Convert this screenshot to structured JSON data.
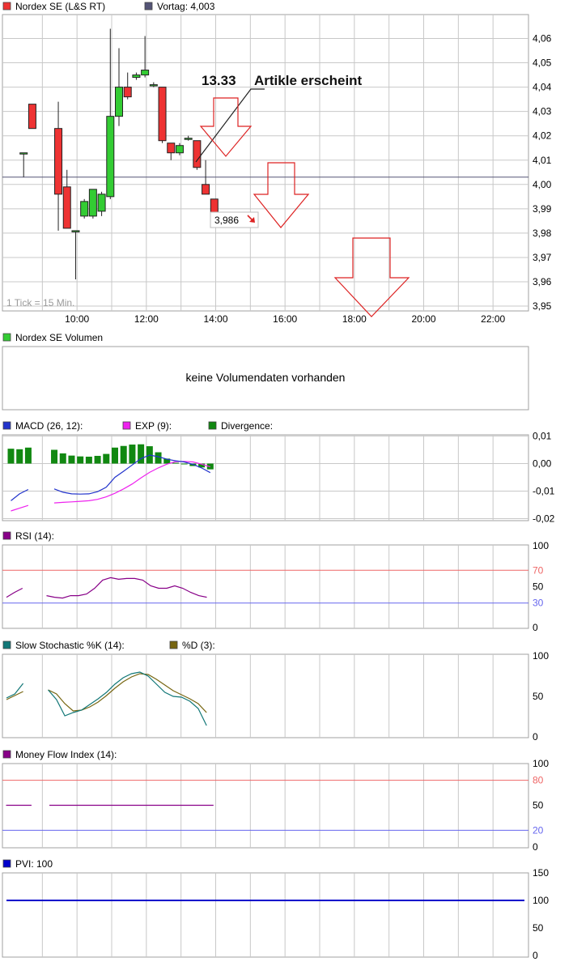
{
  "colors": {
    "up": "#33cc33",
    "down": "#ee3333",
    "grid": "#c8c8c8",
    "frame": "#a0a0a0",
    "prevclose": "#555577",
    "macd": "#2233cc",
    "exp": "#ee22ee",
    "divergence": "#118811",
    "rsi": "#880088",
    "level_high": "#ee6666",
    "level_low": "#6666ee",
    "stoch_k": "#117777",
    "stoch_d": "#776611",
    "mfi": "#880088",
    "pvi": "#0000cc",
    "arrow": "#dd2222"
  },
  "price_panel": {
    "legend_main": "Nordex SE (L&S RT)",
    "legend_prev": "Vortag: 4,003",
    "tick_info": "1 Tick = 15 Min.",
    "last_price_label": "3,986",
    "annotation_time": "13.33",
    "annotation_text": "Artikle erscheint"
  },
  "volume_panel": {
    "legend": "Nordex SE Volumen",
    "no_data": "keine Volumendaten vorhanden"
  },
  "macd_panel": {
    "legend_macd": "MACD (26, 12):",
    "legend_exp": "EXP (9):",
    "legend_div": "Divergence:"
  },
  "rsi_panel": {
    "legend": "RSI (14):"
  },
  "stoch_panel": {
    "legend_k": "Slow Stochastic %K (14):",
    "legend_d": "%D (3):"
  },
  "mfi_panel": {
    "legend": "Money Flow Index (14):"
  },
  "pvi_panel": {
    "legend": "PVI: 100"
  },
  "chart_data": [
    {
      "type": "candlestick",
      "name": "Nordex SE (L&S RT)",
      "interval_minutes": 15,
      "x_tick_labels": [
        "10:00",
        "12:00",
        "14:00",
        "16:00",
        "18:00",
        "20:00",
        "22:00"
      ],
      "xlim": [
        "08:00",
        "23:00"
      ],
      "ylim": [
        3.95,
        4.065
      ],
      "y_ticks": [
        "4,06",
        "4,05",
        "4,04",
        "4,03",
        "4,02",
        "4,01",
        "4,00",
        "3,99",
        "3,98",
        "3,97",
        "3,96",
        "3,95"
      ],
      "prev_close": 4.003,
      "candles": [
        {
          "t": "08:15",
          "o": 4.013,
          "h": 4.013,
          "l": 4.003,
          "c": 4.013
        },
        {
          "t": "08:30",
          "o": 4.033,
          "h": 4.033,
          "l": 4.023,
          "c": 4.023
        },
        {
          "t": "09:15",
          "o": 4.023,
          "h": 4.034,
          "l": 3.981,
          "c": 3.996
        },
        {
          "t": "09:30",
          "o": 3.999,
          "h": 4.006,
          "l": 3.982,
          "c": 3.982
        },
        {
          "t": "09:45",
          "o": 3.981,
          "h": 3.981,
          "l": 3.961,
          "c": 3.981
        },
        {
          "t": "10:00",
          "o": 3.987,
          "h": 3.994,
          "l": 3.986,
          "c": 3.993
        },
        {
          "t": "10:15",
          "o": 3.987,
          "h": 3.998,
          "l": 3.986,
          "c": 3.998
        },
        {
          "t": "10:30",
          "o": 3.989,
          "h": 3.997,
          "l": 3.987,
          "c": 3.996
        },
        {
          "t": "10:45",
          "o": 3.995,
          "h": 4.064,
          "l": 3.994,
          "c": 4.028
        },
        {
          "t": "11:00",
          "o": 4.028,
          "h": 4.056,
          "l": 4.024,
          "c": 4.04
        },
        {
          "t": "11:15",
          "o": 4.04,
          "h": 4.046,
          "l": 4.035,
          "c": 4.036
        },
        {
          "t": "11:30",
          "o": 4.044,
          "h": 4.046,
          "l": 4.043,
          "c": 4.045
        },
        {
          "t": "11:45",
          "o": 4.045,
          "h": 4.061,
          "l": 4.044,
          "c": 4.047
        },
        {
          "t": "12:00",
          "o": 4.041,
          "h": 4.042,
          "l": 4.04,
          "c": 4.041
        },
        {
          "t": "12:15",
          "o": 4.04,
          "h": 4.04,
          "l": 4.017,
          "c": 4.018
        },
        {
          "t": "12:30",
          "o": 4.017,
          "h": 4.017,
          "l": 4.01,
          "c": 4.013
        },
        {
          "t": "12:45",
          "o": 4.013,
          "h": 4.017,
          "l": 4.012,
          "c": 4.016
        },
        {
          "t": "13:00",
          "o": 4.019,
          "h": 4.02,
          "l": 4.018,
          "c": 4.019
        },
        {
          "t": "13:15",
          "o": 4.018,
          "h": 4.018,
          "l": 4.006,
          "c": 4.007
        },
        {
          "t": "13:30",
          "o": 4.0,
          "h": 4.01,
          "l": 3.996,
          "c": 3.996
        },
        {
          "t": "13:45",
          "o": 3.994,
          "h": 3.994,
          "l": 3.984,
          "c": 3.986
        }
      ]
    },
    {
      "type": "line",
      "name": "MACD (26, 12)",
      "ylim": [
        -0.02,
        0.01
      ],
      "y_ticks": [
        "0,01",
        "0,00",
        "-0,01",
        "-0,02"
      ],
      "times": [
        "08:00",
        "08:15",
        "08:30",
        "08:45",
        "09:00",
        "09:15",
        "09:30",
        "09:45",
        "10:00",
        "10:15",
        "10:30",
        "10:45",
        "11:00",
        "11:15",
        "11:30",
        "11:45",
        "12:00",
        "12:15",
        "12:30",
        "12:45",
        "13:00",
        "13:15",
        "13:30",
        "13:45"
      ],
      "series": [
        {
          "name": "MACD",
          "values": [
            -0.0135,
            -0.011,
            -0.0094,
            null,
            null,
            -0.0092,
            -0.0104,
            -0.011,
            -0.0111,
            -0.011,
            -0.0102,
            -0.0086,
            -0.005,
            -0.0028,
            -0.0005,
            0.0018,
            0.0031,
            0.0025,
            0.0016,
            0.001,
            0.0006,
            -0.0003,
            -0.0016,
            -0.0033
          ]
        },
        {
          "name": "EXP (9)",
          "values": [
            -0.0172,
            -0.0162,
            -0.0152,
            null,
            null,
            -0.0143,
            -0.0141,
            -0.0139,
            -0.0137,
            -0.0135,
            -0.013,
            -0.0121,
            -0.0108,
            -0.0092,
            -0.0074,
            -0.0052,
            -0.0032,
            -0.0016,
            -0.0002,
            0.0007,
            0.0008,
            0.0006,
            -0.0002,
            -0.0012
          ]
        },
        {
          "name": "Divergence",
          "values": [
            0.0054,
            0.0052,
            0.0058,
            null,
            null,
            0.005,
            0.0037,
            0.0029,
            0.0026,
            0.0025,
            0.0028,
            0.0035,
            0.0058,
            0.0064,
            0.0069,
            0.007,
            0.0063,
            0.0041,
            0.0018,
            0.0003,
            -0.0002,
            -0.0009,
            -0.0014,
            -0.0021
          ]
        }
      ]
    },
    {
      "type": "line",
      "name": "RSI (14)",
      "ylim": [
        0,
        100
      ],
      "y_ticks": [
        "100",
        "70",
        "50",
        "30",
        "0"
      ],
      "levels": [
        70,
        30
      ],
      "series": [
        {
          "name": "RSI",
          "values": [
            37,
            43,
            48,
            null,
            null,
            39,
            37,
            36,
            39,
            39,
            41,
            48,
            58,
            61,
            59,
            60,
            60,
            58,
            51,
            48,
            48,
            51,
            48,
            43,
            39,
            37
          ]
        }
      ]
    },
    {
      "type": "line",
      "name": "Slow Stochastic",
      "ylim": [
        0,
        100
      ],
      "y_ticks": [
        "100",
        "50",
        "0"
      ],
      "series": [
        {
          "name": "%K (14)",
          "values": [
            48,
            53,
            66,
            null,
            null,
            58,
            46,
            26,
            30,
            33,
            40,
            47,
            55,
            65,
            73,
            78,
            80,
            75,
            65,
            55,
            50,
            49,
            44,
            35,
            14
          ]
        },
        {
          "name": "%D (3)",
          "values": [
            46,
            51,
            56,
            null,
            null,
            58,
            53,
            41,
            32,
            33,
            37,
            43,
            51,
            60,
            68,
            74,
            78,
            77,
            71,
            64,
            57,
            52,
            47,
            41,
            30
          ]
        }
      ]
    },
    {
      "type": "line",
      "name": "Money Flow Index (14)",
      "ylim": [
        0,
        100
      ],
      "y_ticks": [
        "100",
        "80",
        "50",
        "20",
        "0"
      ],
      "levels": [
        80,
        20
      ],
      "series": [
        {
          "name": "MFI",
          "segments": [
            {
              "from": "08:00",
              "to": "08:30",
              "value": 50
            },
            {
              "from": "09:15",
              "to": "13:45",
              "value": 50
            }
          ]
        }
      ]
    },
    {
      "type": "line",
      "name": "PVI",
      "ylim": [
        0,
        150
      ],
      "y_ticks": [
        "150",
        "100",
        "50",
        "0"
      ],
      "series": [
        {
          "name": "PVI",
          "values": [
            100,
            100
          ]
        }
      ]
    }
  ]
}
